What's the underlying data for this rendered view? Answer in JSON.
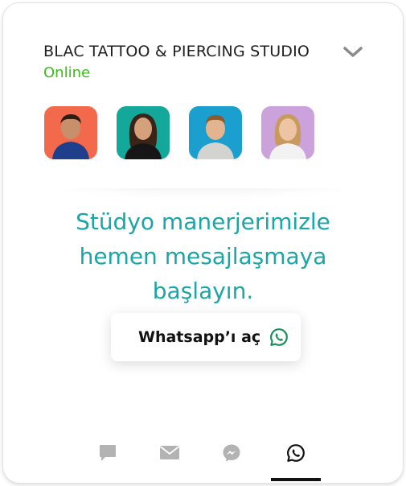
{
  "header": {
    "studio_name": "BLAC TATTOO & PIERCING STUDIO",
    "status": "Online",
    "status_color": "#3dbc1e",
    "expand_icon": "chevron-down-icon"
  },
  "team": [
    {
      "name": "agent-1",
      "bg": "#f26a4b"
    },
    {
      "name": "agent-2",
      "bg": "#14a89a"
    },
    {
      "name": "agent-3",
      "bg": "#1a9fcf"
    },
    {
      "name": "agent-4",
      "bg": "#cba2dc"
    }
  ],
  "main": {
    "headline": "Stüdyo manerjerimizle hemen mesajlaşmaya başlayın.",
    "headline_color": "#1aa6a6",
    "cta_label": "Whatsapp’ı aç",
    "cta_icon": "whatsapp-icon"
  },
  "tabs": [
    {
      "icon": "chat-icon",
      "active": false
    },
    {
      "icon": "mail-icon",
      "active": false
    },
    {
      "icon": "messenger-icon",
      "active": false
    },
    {
      "icon": "whatsapp-icon",
      "active": true
    }
  ]
}
